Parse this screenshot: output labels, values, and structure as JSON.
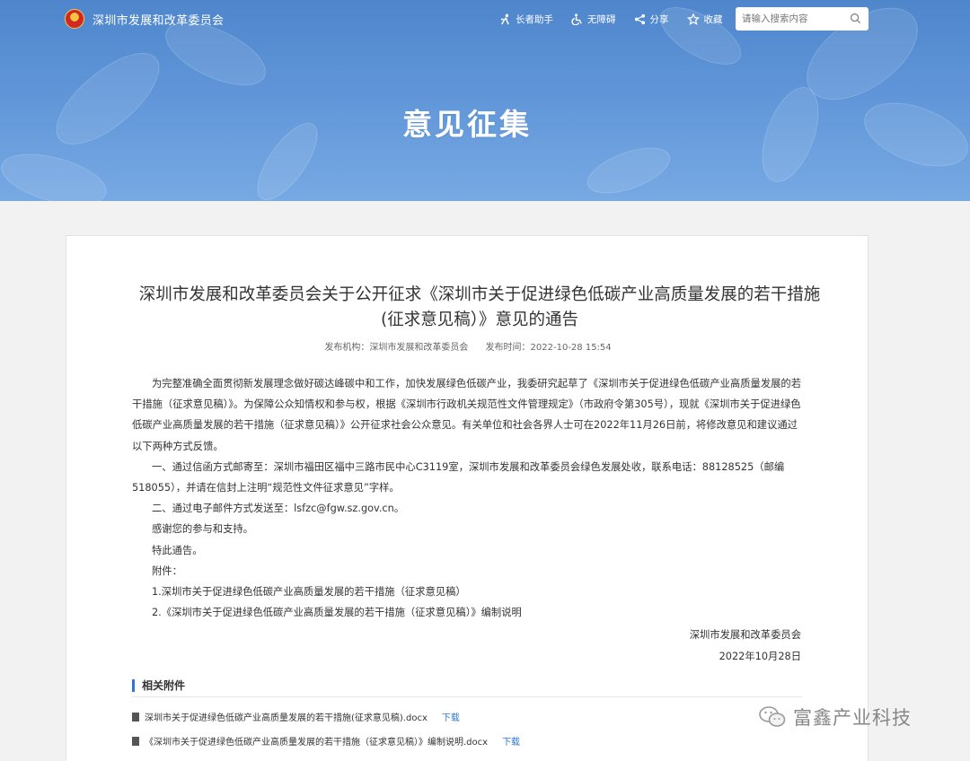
{
  "header": {
    "brand_name": "深圳市发展和改革委员会",
    "tools": [
      {
        "label": "长者助手",
        "icon": "elder-icon"
      },
      {
        "label": "无障碍",
        "icon": "accessibility-icon"
      },
      {
        "label": "分享",
        "icon": "share-icon"
      },
      {
        "label": "收藏",
        "icon": "star-icon"
      }
    ],
    "search_placeholder": "请输入搜索内容"
  },
  "banner": {
    "title": "意见征集"
  },
  "article": {
    "title_line1": "深圳市发展和改革委员会关于公开征求《深圳市关于促进绿色低碳产业高质量发展的若干措施",
    "title_line2": "(征求意见稿）》意见的通告",
    "publisher_label": "发布机构：",
    "publisher": "深圳市发展和改革委员会",
    "date_label": "发布时间：",
    "date": "2022-10-28 15:54",
    "paragraphs": [
      "为完整准确全面贯彻新发展理念做好碳达峰碳中和工作，加快发展绿色低碳产业，我委研究起草了《深圳市关于促进绿色低碳产业高质量发展的若干措施（征求意见稿）》。为保障公众知情权和参与权，根据《深圳市行政机关规范性文件管理规定》（市政府令第305号），现就《深圳市关于促进绿色低碳产业高质量发展的若干措施（征求意见稿）》公开征求社会公众意见。有关单位和社会各界人士可在2022年11月26日前，将修改意见和建议通过以下两种方式反馈。",
      "一、通过信函方式邮寄至：深圳市福田区福中三路市民中心C3119室，深圳市发展和改革委员会绿色发展处收，联系电话：88128525（邮编518055），并请在信封上注明“规范性文件征求意见”字样。",
      "二、通过电子邮件方式发送至：lsfzc@fgw.sz.gov.cn。",
      "感谢您的参与和支持。",
      "特此通告。",
      "附件：",
      "1.深圳市关于促进绿色低碳产业高质量发展的若干措施（征求意见稿）",
      "2.《深圳市关于促进绿色低碳产业高质量发展的若干措施（征求意见稿）》编制说明"
    ],
    "signature": "深圳市发展和改革委员会",
    "sign_date": "2022年10月28日"
  },
  "attachments": {
    "heading": "相关附件",
    "items": [
      {
        "name": "深圳市关于促进绿色低碳产业高质量发展的若干措施(征求意见稿).docx",
        "action": "下载"
      },
      {
        "name": "《深圳市关于促进绿色低碳产业高质量发展的若干措施（征求意见稿）》编制说明.docx",
        "action": "下载"
      }
    ]
  },
  "watermark": {
    "text": "富鑫产业科技"
  },
  "colors": {
    "banner": "#5f95d8",
    "accent": "#2f78d1"
  }
}
